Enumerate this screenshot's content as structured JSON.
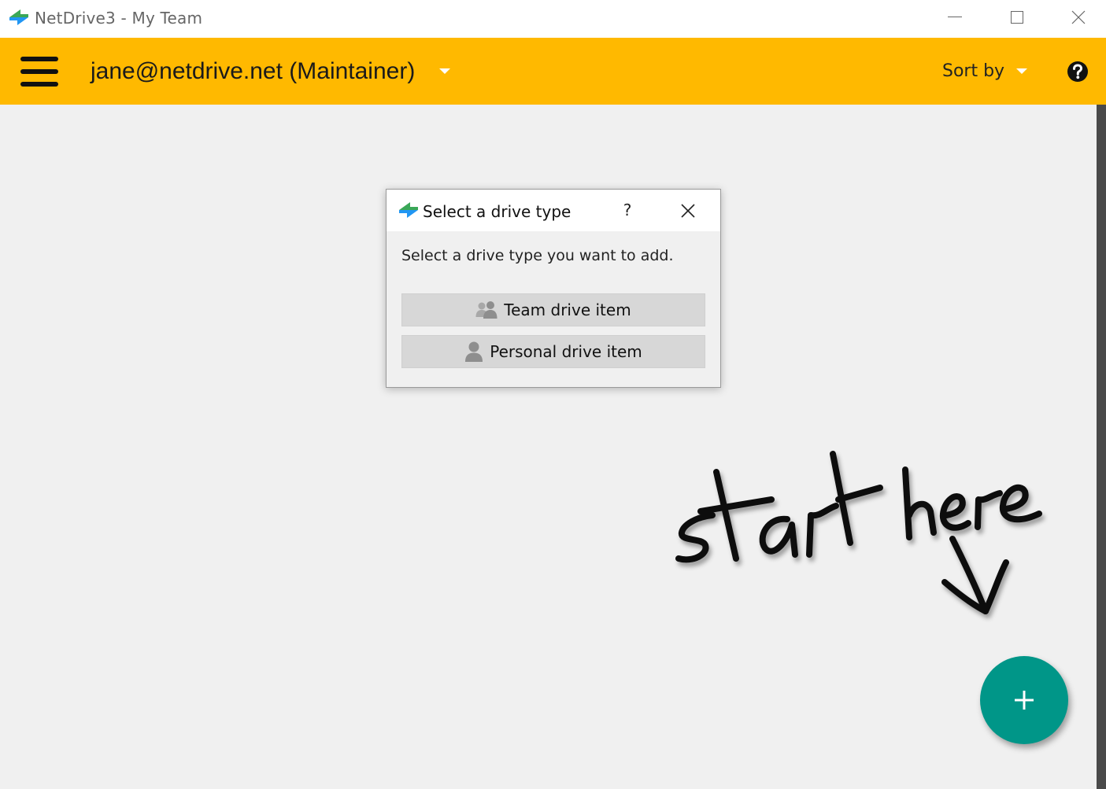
{
  "window": {
    "title": "NetDrive3 - My Team"
  },
  "toolbar": {
    "account_label": "jane@netdrive.net (Maintainer)",
    "sort_label": "Sort by",
    "background_color": "#ffb900"
  },
  "dialog": {
    "title": "Select a drive type",
    "help_label": "?",
    "message": "Select a drive type you want to add.",
    "buttons": [
      {
        "label": "Team drive item",
        "icon": "team-icon"
      },
      {
        "label": "Personal drive item",
        "icon": "person-icon"
      }
    ]
  },
  "hint": {
    "text": "start here",
    "icon": "arrow-down-icon"
  },
  "fab": {
    "icon": "plus-icon",
    "color": "#009688"
  }
}
